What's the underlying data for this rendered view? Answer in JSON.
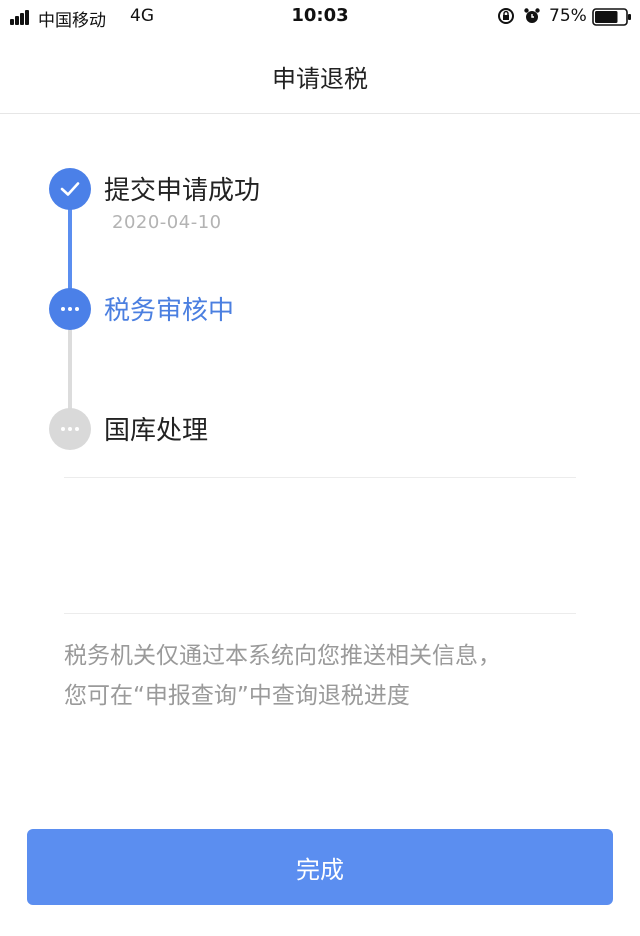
{
  "status_bar": {
    "carrier": "中国移动",
    "network": "4G",
    "time": "10:03",
    "battery_percent": "75%",
    "battery_level": 0.75
  },
  "header": {
    "title": "申请退税"
  },
  "timeline": {
    "steps": [
      {
        "label": "提交申请成功",
        "date": "2020-04-10",
        "state": "completed"
      },
      {
        "label": "税务审核中",
        "state": "in-progress"
      },
      {
        "label": "国库处理",
        "state": "pending"
      }
    ],
    "colors": {
      "active": "#4b80e8",
      "active_text": "#4b7fe0",
      "inactive": "#d9d9d9"
    }
  },
  "notice": {
    "line1": "税务机关仅通过本系统向您推送相关信息，",
    "line2": "您可在“申报查询”中查询退税进度"
  },
  "footer": {
    "done_label": "完成",
    "button_color": "#5b8ef0"
  }
}
